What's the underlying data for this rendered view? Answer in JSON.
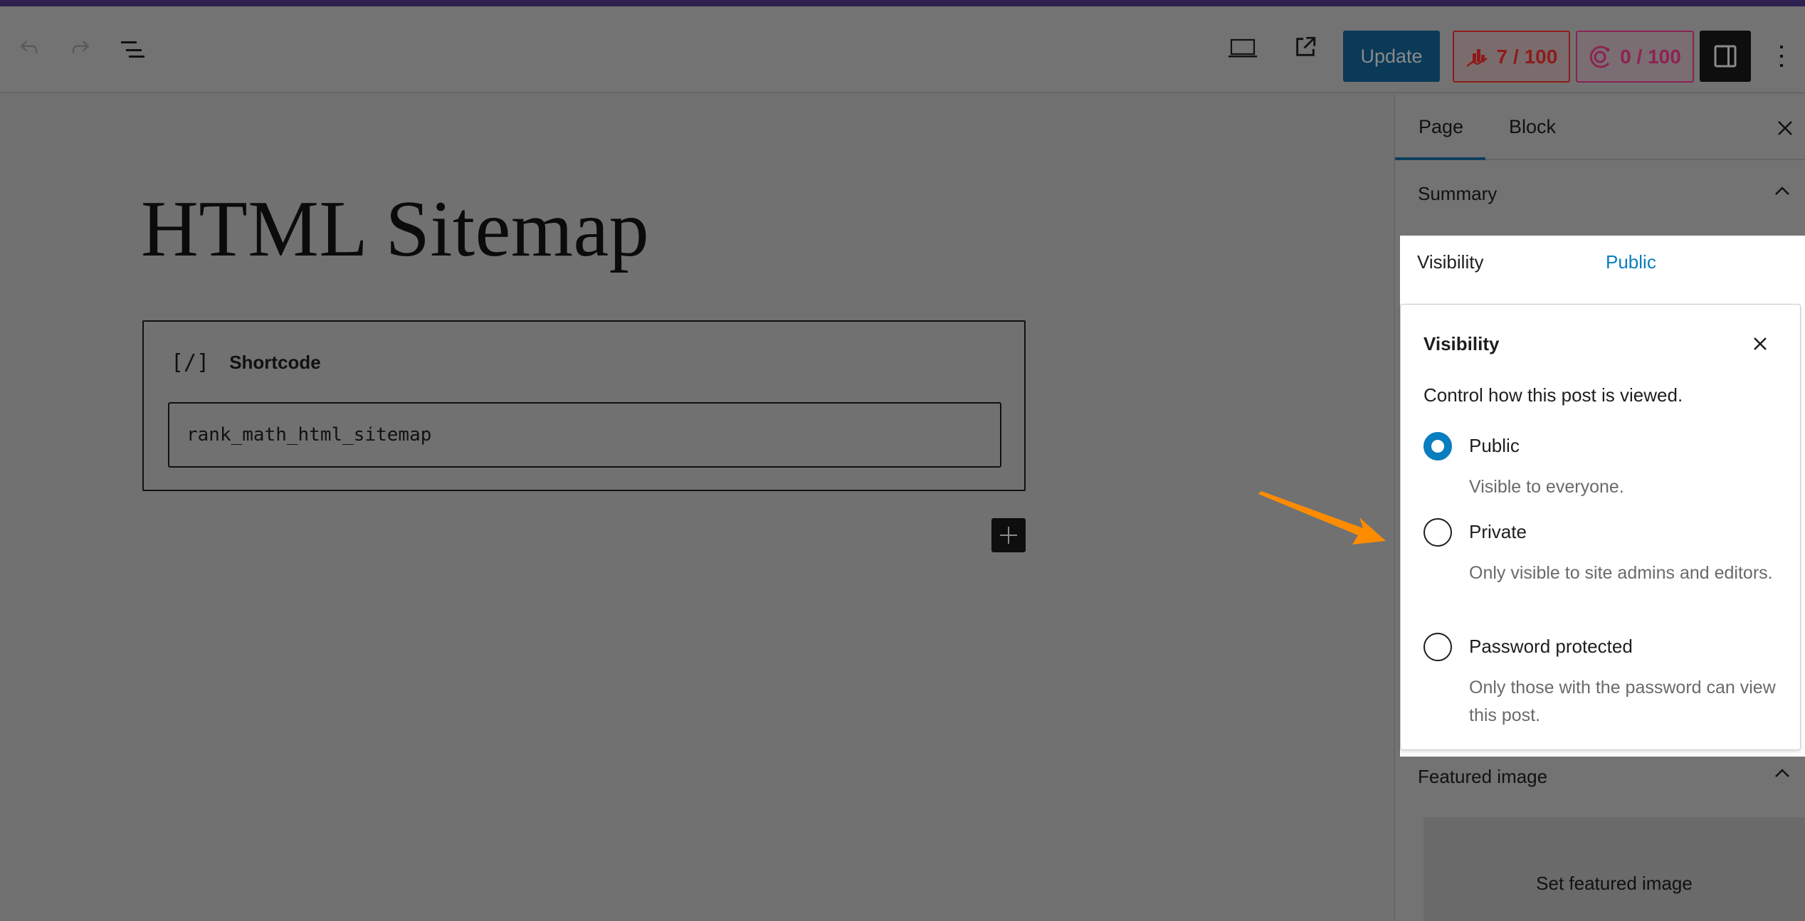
{
  "toolbar": {
    "undo_icon": "undo-icon",
    "redo_icon": "redo-icon",
    "list_view_icon": "list-view-icon",
    "preview_icon": "desktop-preview-icon",
    "view_page_icon": "external-link-icon",
    "update_label": "Update",
    "seo_score": "7 / 100",
    "seo_icon": "rank-math-seo-score-icon",
    "ai_score": "0 / 100",
    "ai_icon": "content-ai-score-icon",
    "sidebar_toggle_icon": "sidebar-toggle-icon",
    "options_icon": "more-vertical-icon"
  },
  "editor": {
    "page_title": "HTML Sitemap",
    "block": {
      "icon_glyph": "[/]",
      "label": "Shortcode",
      "value": "rank_math_html_sitemap"
    },
    "add_block_icon": "plus-icon"
  },
  "sidebar": {
    "tabs": [
      {
        "label": "Page",
        "active": true
      },
      {
        "label": "Block",
        "active": false
      }
    ],
    "close_icon": "close-icon",
    "summary": {
      "heading": "Summary",
      "expanded": true,
      "visibility_label": "Visibility",
      "visibility_value": "Public"
    },
    "featured_image": {
      "heading": "Featured image",
      "expanded": true,
      "button_label": "Set featured image"
    }
  },
  "visibility_popover": {
    "title": "Visibility",
    "description": "Control how this post is viewed.",
    "options": [
      {
        "label": "Public",
        "help": "Visible to everyone.",
        "checked": true
      },
      {
        "label": "Private",
        "help": "Only visible to site admins and editors.",
        "checked": false
      },
      {
        "label": "Password protected",
        "help": "Only those with the password can view this post.",
        "checked": false
      }
    ]
  },
  "annotation": {
    "arrow_color": "#ff8c00",
    "arrow_points_to": "Private"
  },
  "colors": {
    "accent": "#0a7dbf",
    "update_button": "#0a3a58",
    "seo_score": "#8e1b1b",
    "ai_score": "#8c2352"
  }
}
